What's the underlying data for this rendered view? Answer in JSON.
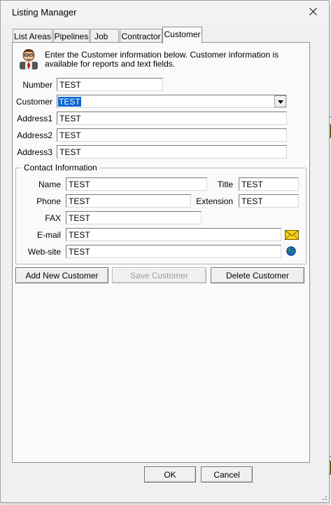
{
  "window": {
    "title": "Listing Manager"
  },
  "tabs": [
    {
      "label": "List Areas",
      "active": false
    },
    {
      "label": "Pipelines",
      "active": false
    },
    {
      "label": "Job",
      "active": false
    },
    {
      "label": "Contractor",
      "active": false
    },
    {
      "label": "Customer",
      "active": true
    }
  ],
  "intro": {
    "icon": "person-icon",
    "text": "Enter the Customer information below. Customer information is available for reports and text fields."
  },
  "customer": {
    "number_label": "Number",
    "number_value": "TEST",
    "customer_label": "Customer",
    "customer_value": "TEST",
    "address1_label": "Address1",
    "address1_value": "TEST",
    "address2_label": "Address2",
    "address2_value": "TEST",
    "address3_label": "Address3",
    "address3_value": "TEST"
  },
  "contact": {
    "group_title": "Contact Information",
    "name_label": "Name",
    "name_value": "TEST",
    "title_label": "Title",
    "title_value": "TEST",
    "phone_label": "Phone",
    "phone_value": "TEST",
    "extension_label": "Extension",
    "extension_value": "TEST",
    "fax_label": "FAX",
    "fax_value": "TEST",
    "email_label": "E-mail",
    "email_value": "TEST",
    "website_label": "Web-site",
    "website_value": "TEST",
    "email_icon": "envelope-icon",
    "website_icon": "globe-icon"
  },
  "actions": {
    "add": "Add New Customer",
    "save": "Save Customer",
    "save_enabled": false,
    "delete": "Delete Customer"
  },
  "footer": {
    "ok": "OK",
    "cancel": "Cancel"
  }
}
